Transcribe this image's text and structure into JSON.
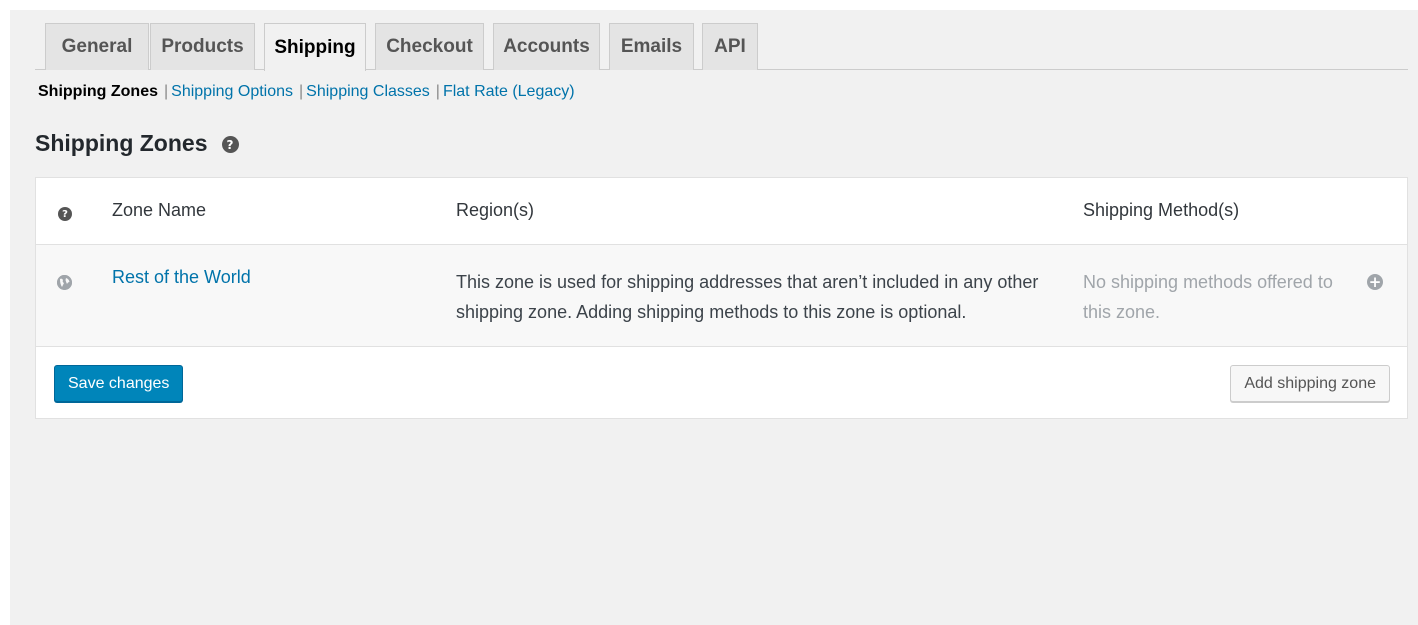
{
  "tabs": [
    {
      "label": "General"
    },
    {
      "label": "Products"
    },
    {
      "label": "Shipping"
    },
    {
      "label": "Checkout"
    },
    {
      "label": "Accounts"
    },
    {
      "label": "Emails"
    },
    {
      "label": "API"
    }
  ],
  "active_tab": "Shipping",
  "subnav": {
    "current": "Shipping Zones",
    "links": [
      "Shipping Options",
      "Shipping Classes",
      "Flat Rate (Legacy)"
    ],
    "separator": "|"
  },
  "page_title": "Shipping Zones",
  "help_icon": "?",
  "table": {
    "headers": {
      "zone_name": "Zone Name",
      "regions": "Region(s)",
      "methods": "Shipping Method(s)"
    },
    "rows": [
      {
        "icon": "globe-icon",
        "zone_name": "Rest of the World",
        "regions": "This zone is used for shipping addresses that aren’t included in any other shipping zone. Adding shipping methods to this zone is optional.",
        "methods": "No shipping methods offered to this zone."
      }
    ]
  },
  "buttons": {
    "save": "Save changes",
    "add_zone": "Add shipping zone"
  },
  "colors": {
    "link": "#0073aa",
    "primary_button": "#0085ba",
    "background": "#f1f1f1"
  }
}
